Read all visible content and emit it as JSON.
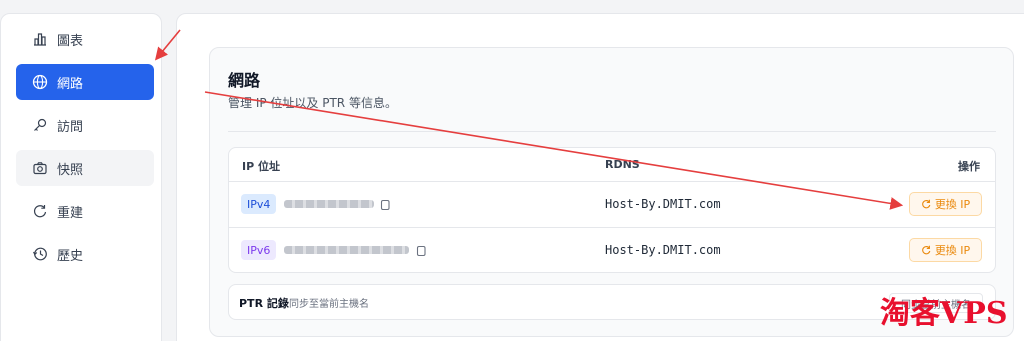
{
  "sidebar": {
    "items": [
      {
        "label": "圖表",
        "icon": "chart-icon"
      },
      {
        "label": "網路",
        "icon": "globe-icon",
        "active": true
      },
      {
        "label": "訪問",
        "icon": "key-icon"
      },
      {
        "label": "快照",
        "icon": "camera-icon"
      },
      {
        "label": "重建",
        "icon": "rotate-icon"
      },
      {
        "label": "歷史",
        "icon": "history-icon"
      }
    ]
  },
  "network": {
    "title": "網路",
    "description": "管理 IP 位址以及 PTR 等信息。",
    "columns": [
      "IP 位址",
      "RDNS",
      "操作"
    ],
    "rows": [
      {
        "type": "IPv4",
        "rdns": "Host-By.DMIT.com",
        "action": "更換 IP"
      },
      {
        "type": "IPv6",
        "rdns": "Host-By.DMIT.com",
        "action": "更換 IP"
      }
    ],
    "ptr": {
      "label": "PTR 記錄",
      "description": "同步至當前主機名",
      "action": "同步當前主機名"
    }
  },
  "watermark": "淘客VPS",
  "colors": {
    "accent": "#2563eb",
    "warn": "#ea8a0e",
    "annotation": "#e53e3e"
  }
}
